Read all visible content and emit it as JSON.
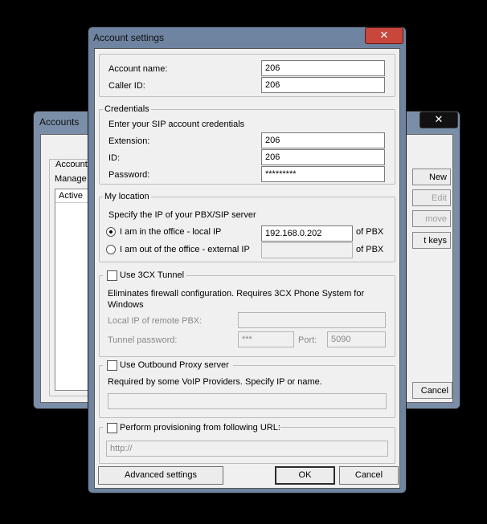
{
  "accounts_window": {
    "title": "Accounts",
    "close_glyph": "✕",
    "group_label": "Accounts",
    "manage_text": "Manage SI",
    "column_active": "Active",
    "buttons": {
      "new": "New",
      "edit": "Edit",
      "remove": "move",
      "keys": "t keys",
      "cancel": "Cancel"
    }
  },
  "dialog": {
    "title": "Account settings",
    "close_glyph": "✕",
    "account": {
      "name_label": "Account name:",
      "name_value": "206",
      "caller_id_label": "Caller ID:",
      "caller_id_value": "206"
    },
    "credentials": {
      "group_label": "Credentials",
      "hint": "Enter your SIP account credentials",
      "extension_label": "Extension:",
      "extension_value": "206",
      "id_label": "ID:",
      "id_value": "206",
      "password_label": "Password:",
      "password_value": "*********"
    },
    "location": {
      "group_label": "My location",
      "hint": "Specify the IP of your PBX/SIP server",
      "local_label": "I am in the office - local IP",
      "local_value": "192.168.0.202",
      "local_suffix": "of PBX",
      "external_label": "I am out of the office - external IP",
      "external_value": "",
      "external_suffix": "of PBX",
      "selected": "local"
    },
    "tunnel": {
      "checkbox_label": "Use 3CX Tunnel",
      "checked": false,
      "description": "Eliminates firewall configuration. Requires 3CX Phone System for Windows",
      "remote_label": "Local IP of remote PBX:",
      "remote_value": "",
      "password_label": "Tunnel password:",
      "password_value": "***",
      "port_label": "Port:",
      "port_value": "5090"
    },
    "proxy": {
      "checkbox_label": "Use Outbound Proxy server",
      "checked": false,
      "description": "Required by some VoIP Providers. Specify IP or name.",
      "value": ""
    },
    "provisioning": {
      "checkbox_label": "Perform provisioning from following URL:",
      "checked": false,
      "value": "http://"
    },
    "buttons": {
      "advanced": "Advanced settings",
      "ok": "OK",
      "cancel": "Cancel"
    }
  }
}
